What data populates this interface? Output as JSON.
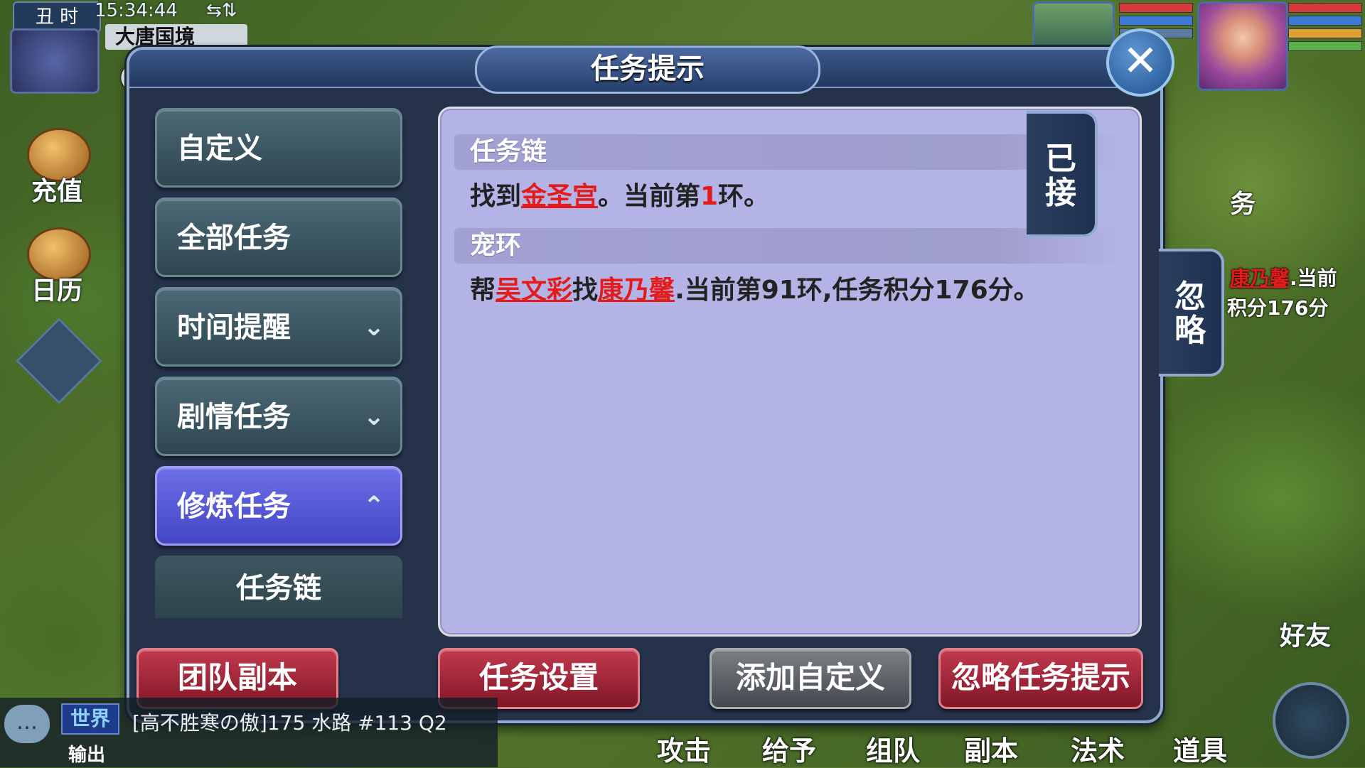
{
  "hud": {
    "shichen": "丑 时",
    "clock": "15:34:44",
    "sync_icon": "signal-arrows-icon",
    "map_name": "大唐国境",
    "map_coords": "("
  },
  "side_icons": [
    {
      "label": "充值",
      "icon": "treasure-chest-icon"
    },
    {
      "label": "日历",
      "icon": "calendar-dial-icon"
    }
  ],
  "dialog": {
    "title": "任务提示",
    "close_icon": "close-x-icon",
    "tabs": [
      {
        "label": "自定义",
        "chevron": ""
      },
      {
        "label": "全部任务",
        "chevron": ""
      },
      {
        "label": "时间提醒",
        "chevron": "⌄"
      },
      {
        "label": "剧情任务",
        "chevron": "⌄"
      },
      {
        "label": "修炼任务",
        "chevron": "⌃"
      }
    ],
    "sub_tab": "任务链",
    "sections": [
      {
        "header": "任务链",
        "t1": "找到",
        "link1": "金圣宫",
        "t2": "。当前第",
        "num": "1",
        "t3": "环。"
      },
      {
        "header": "宠环",
        "t1": "帮",
        "link1": "吴文彩",
        "t2": "找",
        "link2": "康乃馨",
        "t3": ".当前第91环,任务积分176分。"
      }
    ],
    "side_tabs": [
      {
        "label": "已接"
      },
      {
        "label": "忽略"
      }
    ],
    "buttons": {
      "team_dungeon": "团队副本",
      "task_settings": "任务设置",
      "add_custom": "添加自定义",
      "ignore_hint": "忽略任务提示"
    }
  },
  "behind_text": {
    "right_snippet_link": "康乃馨",
    "right_snippet_1": ".当前",
    "right_snippet_2": "积分176分",
    "right_tab_fragment": "务"
  },
  "right_icons": {
    "friends": "好友"
  },
  "chat": {
    "channel": "世界",
    "message": "[高不胜寒の傲]175 水路 #113 Q2",
    "output": "输出"
  },
  "action_bar": [
    "攻击",
    "给予",
    "组队",
    "副本",
    "法术",
    "道具"
  ],
  "colors": {
    "link_red": "#e51a1a",
    "active_tab": "#5658d8",
    "content_bg": "#b4b3e6",
    "red_button": "#a02538"
  }
}
